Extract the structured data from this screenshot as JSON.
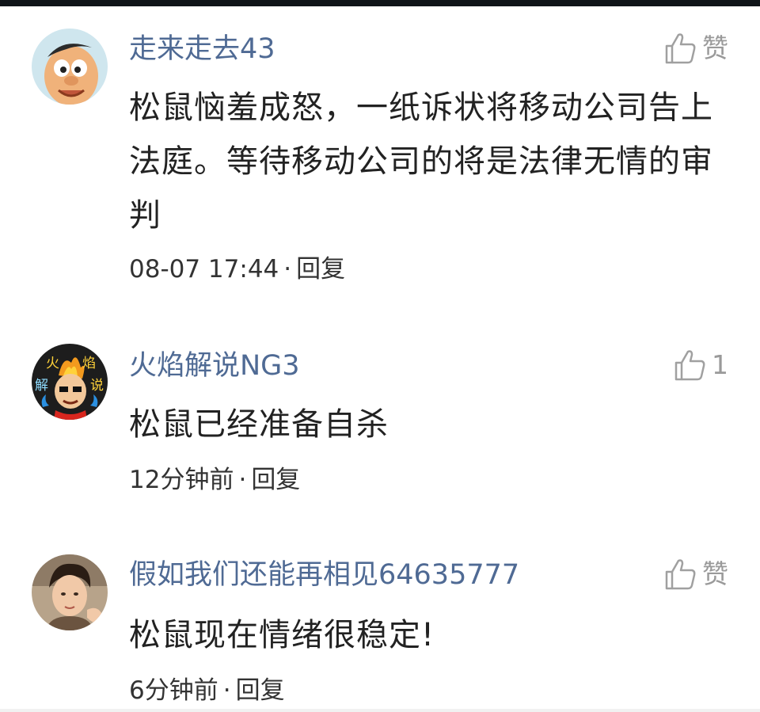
{
  "comments": [
    {
      "username": "走来走去43",
      "like_label": "赞",
      "text": "松鼠恼羞成怒，一纸诉状将移动公司告上法庭。等待移动公司的将是法律无情的审判",
      "time": "08-07 17:44",
      "separator": "·",
      "reply_label": "回复",
      "avatar_icon": "cartoon-boy-avatar"
    },
    {
      "username": "火焰解说NG3",
      "like_label": "1",
      "text": "松鼠已经准备自杀",
      "time": "12分钟前",
      "separator": "·",
      "reply_label": "回复",
      "avatar_icon": "flame-commentator-avatar",
      "avatar_text": [
        "火",
        "焰",
        "解",
        "说"
      ]
    },
    {
      "username": "假如我们还能再相见64635777",
      "like_label": "赞",
      "text": "松鼠现在情绪很稳定!",
      "time": "6分钟前",
      "separator": "·",
      "reply_label": "回复",
      "avatar_icon": "photo-avatar"
    }
  ],
  "colors": {
    "username": "#4f6a94",
    "body": "#222222",
    "meta": "#333333",
    "like": "#9a9a9a"
  }
}
